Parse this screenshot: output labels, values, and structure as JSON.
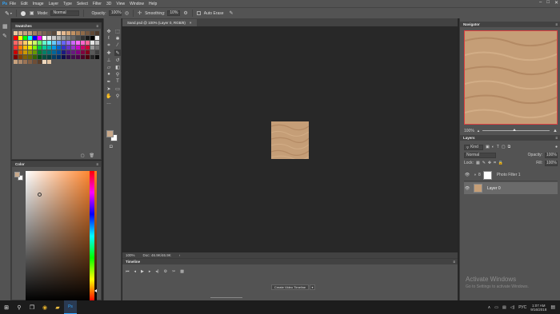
{
  "menu": {
    "app_logo": "Ps",
    "items": [
      "File",
      "Edit",
      "Image",
      "Layer",
      "Type",
      "Select",
      "Filter",
      "3D",
      "View",
      "Window",
      "Help"
    ],
    "window_controls": [
      "–",
      "□",
      "✕"
    ]
  },
  "options": {
    "mode_label": "Mode:",
    "mode_value": "Normal",
    "opacity_label": "Opacity:",
    "opacity_value": "100%",
    "smoothing_label": "Smoothing:",
    "smoothing_value": "10%",
    "auto_erase_label": "Auto Erase"
  },
  "swatches": {
    "title": "Swatches",
    "colors": [
      "#e8c8a0",
      "#d9b38c",
      "#c8a27e",
      "#bfa07c",
      "#a58060",
      "#907060",
      "#7a6252",
      "#6b584a",
      "#5a4a3e",
      "#f4d4b4",
      "#e5b990",
      "#d7a878",
      "#c19264",
      "#a97e54",
      "#8f6a48",
      "#755840",
      "#604936",
      "#4c3a2c",
      "#ff0000",
      "#ffff00",
      "#00ff00",
      "#00ffff",
      "#0000ff",
      "#ff00ff",
      "#ffffff",
      "#e6e6e6",
      "#cccccc",
      "#b3b3b3",
      "#999999",
      "#808080",
      "#666666",
      "#4d4d4d",
      "#333333",
      "#1a1a1a",
      "#000000",
      "#f2f2f2",
      "#ff6666",
      "#ff9966",
      "#ffcc66",
      "#ffff66",
      "#ccff66",
      "#66ff66",
      "#66ffcc",
      "#66ffff",
      "#66ccff",
      "#6699ff",
      "#6666ff",
      "#9966ff",
      "#cc66ff",
      "#ff66ff",
      "#ff66cc",
      "#ff6699",
      "#e6e6e6",
      "#bfbfbf",
      "#ff3333",
      "#ff8000",
      "#ffbf00",
      "#e6e600",
      "#80ff00",
      "#00cc44",
      "#00cc99",
      "#00b3b3",
      "#0099e6",
      "#0066cc",
      "#3333cc",
      "#6633cc",
      "#9933cc",
      "#cc00cc",
      "#cc0066",
      "#cc0033",
      "#999999",
      "#737373",
      "#cc0000",
      "#cc6600",
      "#cc9900",
      "#999900",
      "#669900",
      "#008033",
      "#008066",
      "#007373",
      "#006699",
      "#004d99",
      "#1a1a80",
      "#4d1a80",
      "#661a80",
      "#800080",
      "#800040",
      "#80001a",
      "#595959",
      "#404040",
      "#800000",
      "#804000",
      "#806000",
      "#666600",
      "#336600",
      "#004d1a",
      "#004d40",
      "#004040",
      "#003d66",
      "#002e66",
      "#0d0d4d",
      "#2e0d4d",
      "#400d4d",
      "#4d004d",
      "#4d0026",
      "#4d000d",
      "#262626",
      "#0d0d0d",
      "#c8a27e",
      "#b08a6a",
      "#9a7456",
      "#846044",
      "#6e4e36",
      "#5a3e2a",
      "#efd9bf",
      "#e2c4a2"
    ]
  },
  "color_panel": {
    "title": "Color",
    "foreground": "#c8a88a",
    "background": "#ffffff",
    "hue": "#ff7a1a"
  },
  "document": {
    "tab_title": "Sand.psd @ 100% (Layer 0, RGB/8)",
    "tab_close": "×",
    "zoom": "100%",
    "doc_size": "Doc: 46.9K/46.9K"
  },
  "timeline": {
    "title": "Timeline",
    "create_button": "Create Video Timeline"
  },
  "navigator": {
    "title": "Navigator",
    "zoom": "100%"
  },
  "layers": {
    "title": "Layers",
    "filter_kind": "Kind",
    "blend_mode": "Normal",
    "opacity_label": "Opacity:",
    "opacity_value": "100%",
    "lock_label": "Lock:",
    "fill_label": "Fill:",
    "fill_value": "100%",
    "items": [
      {
        "name": "Photo Filter 1"
      },
      {
        "name": "Layer 0"
      }
    ]
  },
  "watermark": {
    "line1": "Activate Windows",
    "line2": "Go to Settings to activate Windows."
  },
  "taskbar": {
    "time": "1:07 AM",
    "date": "9/16/2018",
    "lang": "РУС"
  }
}
